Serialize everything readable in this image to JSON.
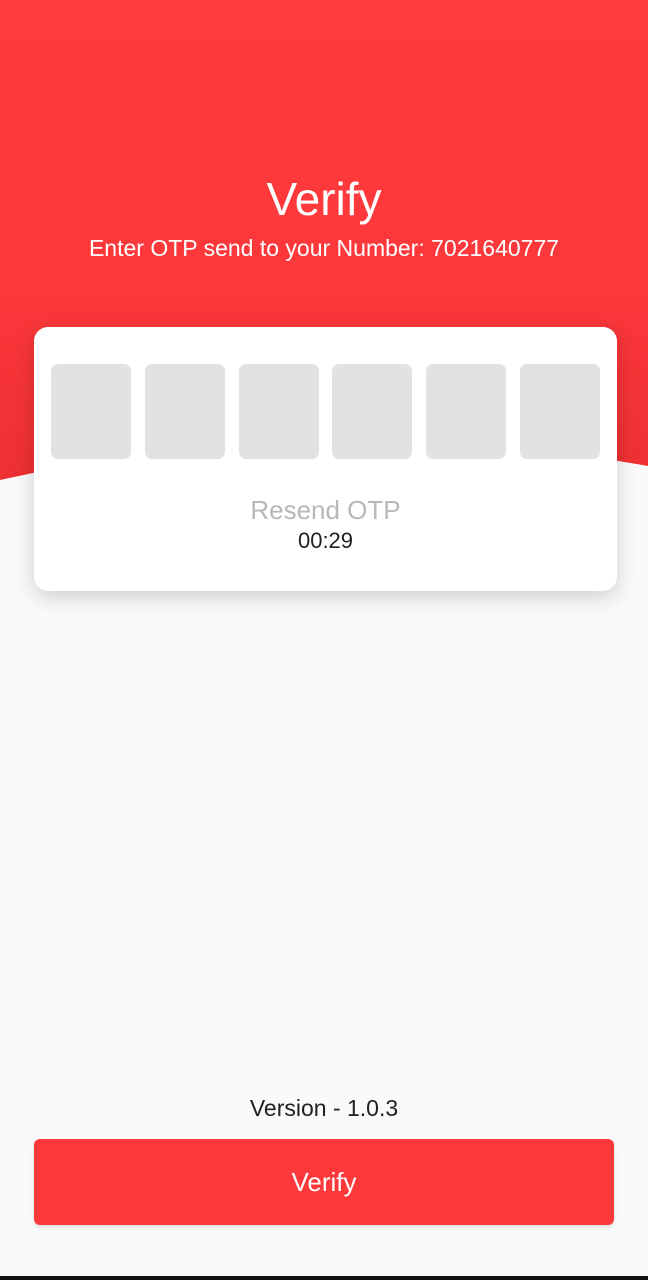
{
  "header": {
    "title": "Verify",
    "subtitle": "Enter OTP send to your Number: 7021640777"
  },
  "otp": {
    "digits": [
      "",
      "",
      "",
      "",
      "",
      ""
    ],
    "resend_label": "Resend OTP",
    "timer": "00:29"
  },
  "footer": {
    "version": "Version - 1.0.3",
    "verify_label": "Verify"
  },
  "colors": {
    "accent": "#fc383b",
    "otp_box": "#e2e2e2",
    "background": "#fafafa",
    "resend_text": "#b8b8b8"
  }
}
